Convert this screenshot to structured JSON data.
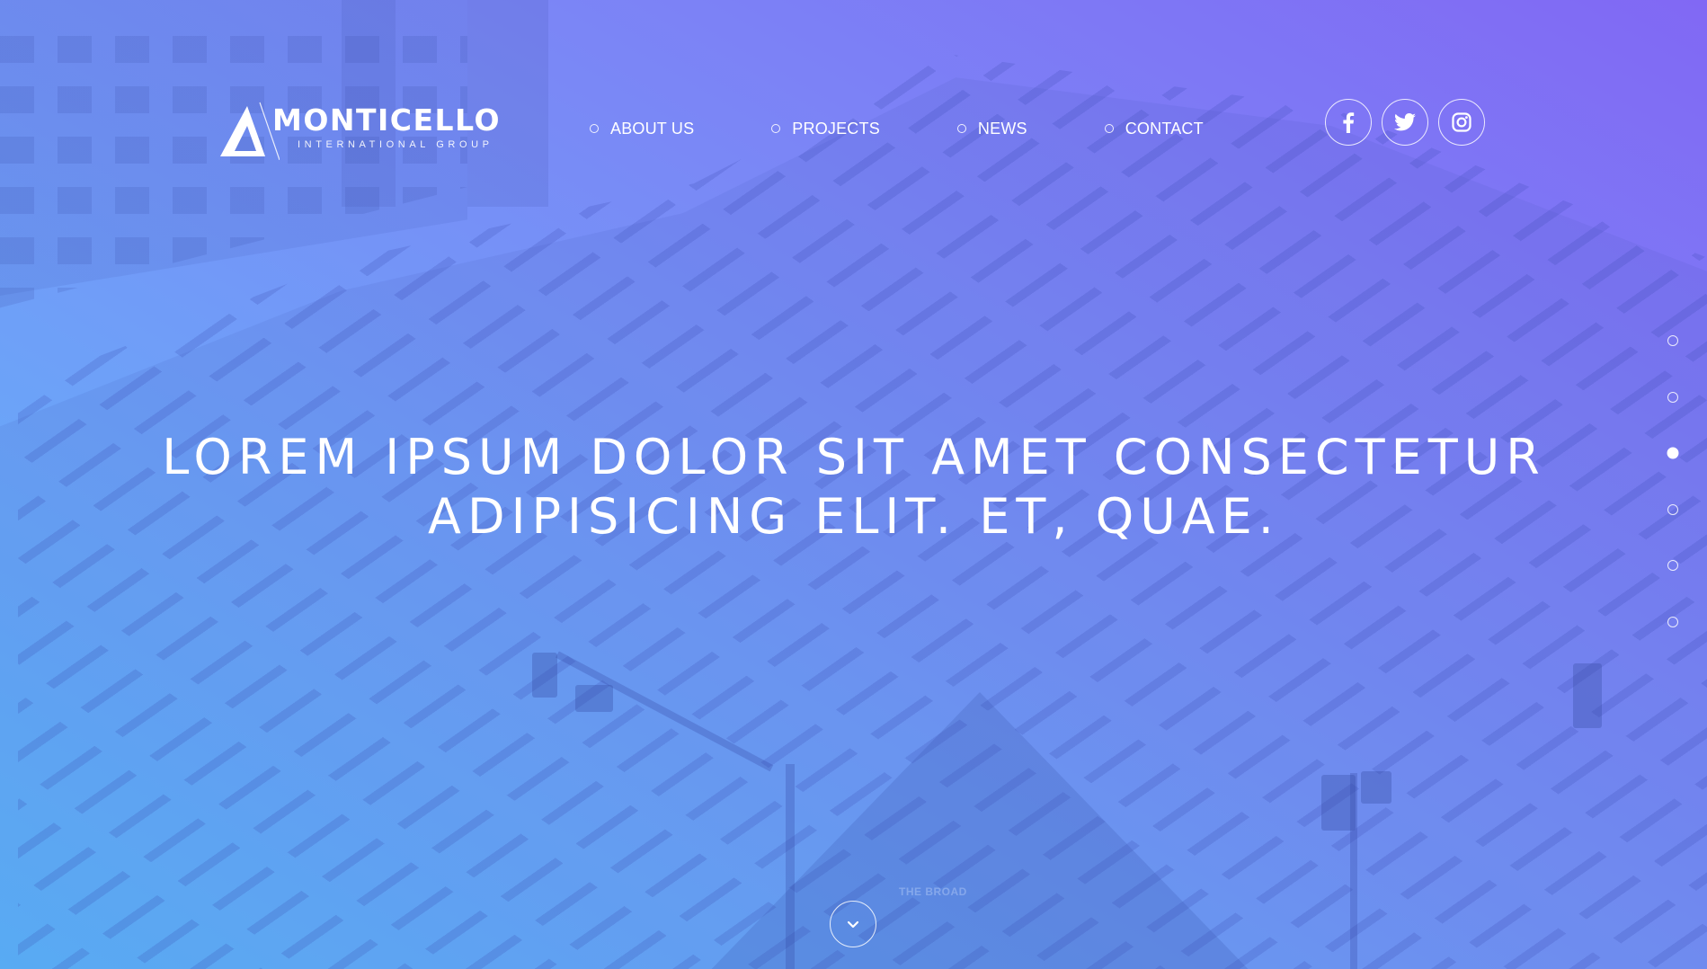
{
  "brand": {
    "name": "MONTICELLO",
    "tagline": "INTERNATIONAL GROUP"
  },
  "nav": {
    "items": [
      {
        "label": "ABOUT US"
      },
      {
        "label": "PROJECTS"
      },
      {
        "label": "NEWS"
      },
      {
        "label": "CONTACT"
      }
    ]
  },
  "social": [
    {
      "icon": "facebook-icon"
    },
    {
      "icon": "twitter-icon"
    },
    {
      "icon": "instagram-icon"
    }
  ],
  "hero": {
    "line1": "LOREM IPSUM DOLOR SIT AMET CONSECTETUR",
    "line2": "ADIPISICING ELIT. ET, QUAE."
  },
  "background_sign": "THE BROAD",
  "pagination": {
    "count": 6,
    "active_index": 2
  },
  "scroll_icon": "chevron-down-icon",
  "colors": {
    "gradient_start": "#5cb6fb",
    "gradient_end": "#8168f4",
    "foreground": "#ffffff"
  }
}
